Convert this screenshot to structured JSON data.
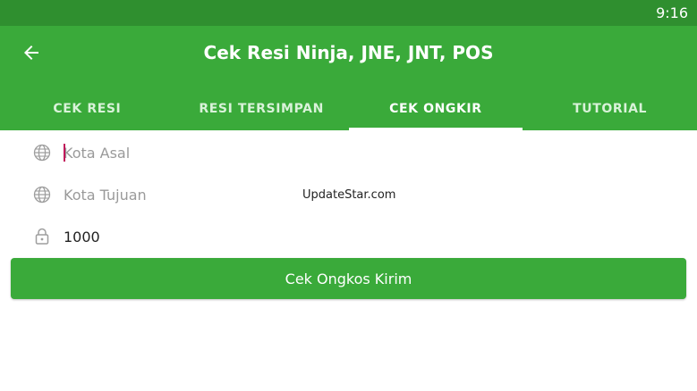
{
  "status_bar": {
    "time": "9:16"
  },
  "app_bar": {
    "title": "Cek Resi Ninja, JNE, JNT, POS",
    "back_icon": "arrow-left-icon"
  },
  "tabs": [
    {
      "label": "CEK RESI",
      "active": false
    },
    {
      "label": "RESI TERSIMPAN",
      "active": false
    },
    {
      "label": "CEK ONGKIR",
      "active": true
    },
    {
      "label": "TUTORIAL",
      "active": false
    }
  ],
  "form": {
    "origin": {
      "placeholder": "Kota Asal",
      "value": "",
      "icon": "globe-icon"
    },
    "destination": {
      "placeholder": "Kota Tujuan",
      "value": "",
      "icon": "globe-icon"
    },
    "weight": {
      "placeholder": "",
      "value": "1000",
      "icon": "lock-icon"
    },
    "submit_label": "Cek Ongkos Kirim"
  },
  "watermark": "UpdateStar.com",
  "colors": {
    "primary": "#3aaa3a",
    "primary_dark": "#2f8f2f",
    "caret": "#c2185b"
  }
}
